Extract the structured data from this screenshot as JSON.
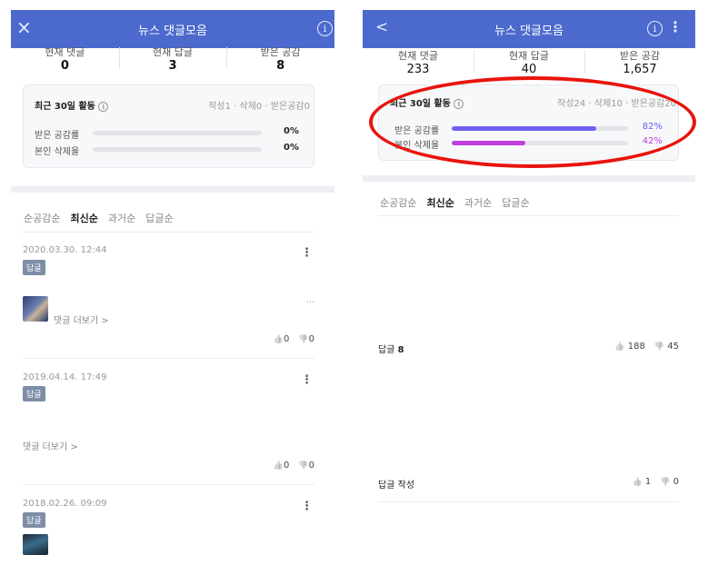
{
  "left": {
    "header": {
      "title": "뉴스 댓글모음",
      "close_icon": "×",
      "info_icon": "i"
    },
    "stats": [
      {
        "label": "현재 댓글",
        "value": "0"
      },
      {
        "label": "현재 답글",
        "value": "3"
      },
      {
        "label": "받은 공감",
        "value": "8"
      }
    ],
    "activity": {
      "title": "최근 30일 활동",
      "info_icon": "i",
      "summary": "작성1 · 삭제0 · 받은공감0",
      "rows": [
        {
          "label": "받은 공감률",
          "percent": "0%",
          "fill": 0
        },
        {
          "label": "본인 삭제율",
          "percent": "0%",
          "fill": 0
        }
      ]
    },
    "sort_tabs": [
      "순공감순",
      "최신순",
      "과거순",
      "답글순"
    ],
    "comments": [
      {
        "date": "2020.03.30. 12:44",
        "badge": "답글",
        "more": "댓글 더보기 >",
        "ellipsis": "...",
        "likes": "0",
        "dislikes": "0"
      },
      {
        "date": "2019.04.14. 17:49",
        "badge": "답글",
        "more": "댓글 더보기 >",
        "likes": "0",
        "dislikes": "0"
      },
      {
        "date": "2018.02.26. 09:09",
        "badge": "답글"
      }
    ],
    "menu_icon": "⋮",
    "like_icon": "👍",
    "dislike_icon": "👎"
  },
  "right": {
    "header": {
      "title": "뉴스 댓글모음",
      "back_icon": "<",
      "info_icon": "i",
      "menu_icon": "⋮"
    },
    "stats": [
      {
        "label": "현재 댓글",
        "value": "233"
      },
      {
        "label": "현재 답글",
        "value": "40"
      },
      {
        "label": "받은 공감",
        "value": "1,657"
      }
    ],
    "activity": {
      "title": "최근 30일 활동",
      "info_icon": "i",
      "summary": "작성24 · 삭제10 · 받은공감20",
      "rows": [
        {
          "label": "받은 공감률",
          "percent": "82%",
          "fill": 0.82,
          "color": "#6d5ff0"
        },
        {
          "label": "본인 삭제율",
          "percent": "42%",
          "fill": 0.42,
          "color": "#c23ee0"
        }
      ]
    },
    "sort_tabs": [
      "순공감순",
      "최신순",
      "과거순",
      "답글순"
    ],
    "comments": [
      {
        "reply_label": "답글",
        "reply_count": "8",
        "likes": "188",
        "dislikes": "45"
      },
      {
        "reply_label": "답글 작성",
        "likes": "1",
        "dislikes": "0"
      }
    ]
  },
  "colors": {
    "header": "#4c6acd",
    "highlight": "#e8140c",
    "badge": "#7d8ea6"
  }
}
